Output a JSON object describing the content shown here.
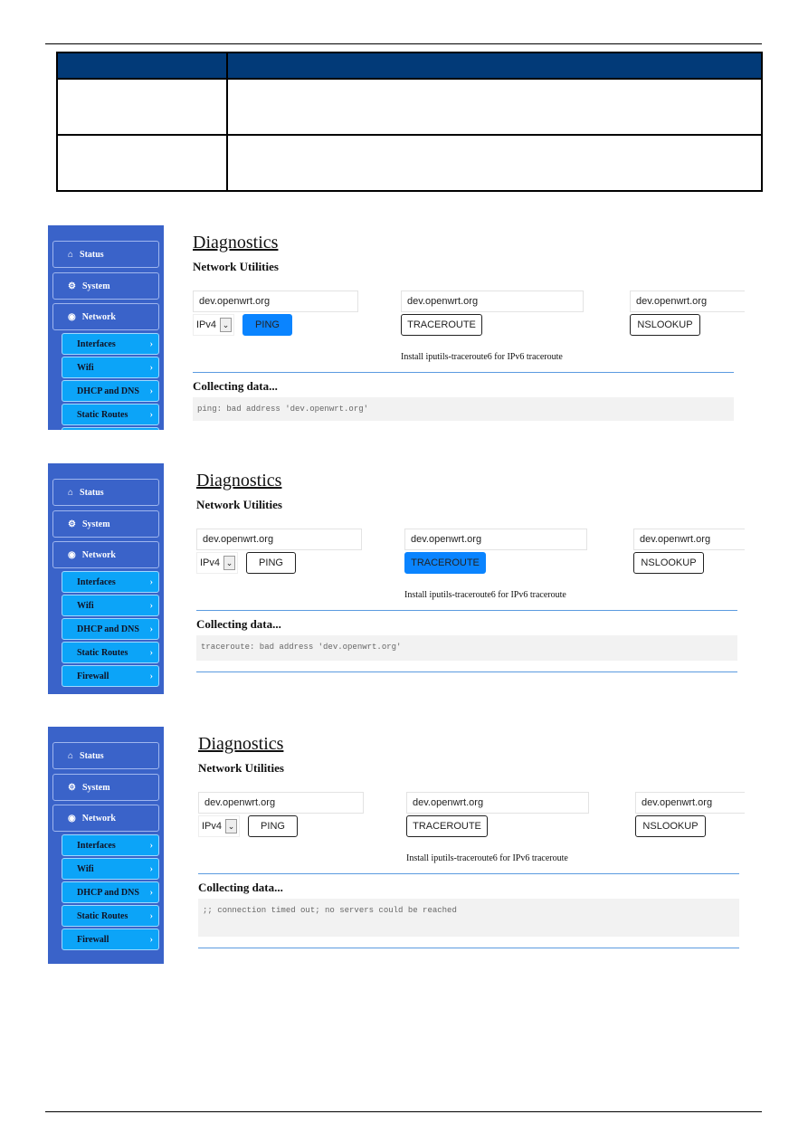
{
  "table": {
    "header": [
      "",
      ""
    ],
    "rows": [
      [
        "",
        ""
      ],
      [
        "",
        ""
      ]
    ]
  },
  "common": {
    "sidebar": [
      {
        "label": "Status",
        "icon": "home-icon"
      },
      {
        "label": "System",
        "icon": "gears-icon"
      },
      {
        "label": "Network",
        "icon": "globe-icon"
      }
    ],
    "submenu": [
      "Interfaces",
      "Wifi",
      "DHCP and DNS",
      "Static Routes",
      "Firewall"
    ],
    "title": "Diagnostics",
    "subtitle": "Network Utilities",
    "ping_host": "dev.openwrt.org",
    "traceroute_host": "dev.openwrt.org",
    "nslookup_host": "dev.openwrt.org",
    "ip_version": "IPv4",
    "ping_label": "PING",
    "traceroute_label": "TRACEROUTE",
    "nslookup_label": "NSLOOKUP",
    "hint": "Install iputils-traceroute6 for IPv6 traceroute",
    "collecting": "Collecting data..."
  },
  "screenshots": [
    {
      "active_button": "ping",
      "output": "ping: bad address 'dev.openwrt.org'"
    },
    {
      "active_button": "traceroute",
      "output": "traceroute: bad address 'dev.openwrt.org'"
    },
    {
      "active_button": "none",
      "output": ";; connection timed out; no servers could be reached"
    }
  ],
  "colors": {
    "sidebar": "#3a63c9",
    "submenu": "#0ca4f8",
    "active_button": "#0a84ff",
    "table_header": "#023a78"
  }
}
